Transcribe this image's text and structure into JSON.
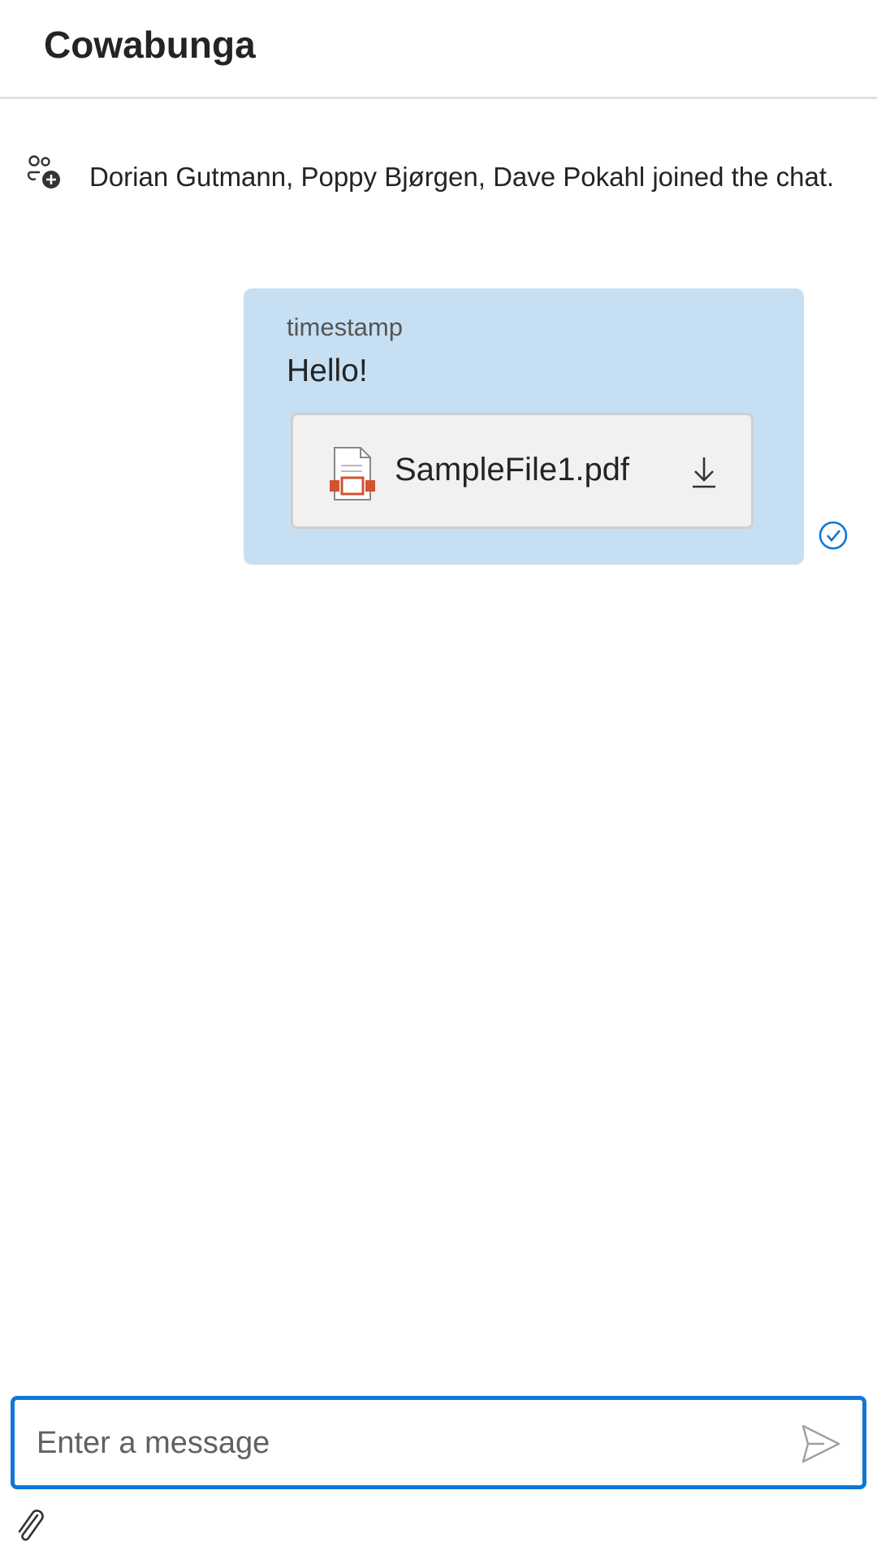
{
  "header": {
    "title": "Cowabunga"
  },
  "system_message": {
    "icon": "person-add-icon",
    "text": "Dorian Gutmann, Poppy Bjørgen, Dave Pokahl joined the chat."
  },
  "message": {
    "timestamp": "timestamp",
    "text": "Hello!",
    "attachment": {
      "name": "SampleFile1.pdf",
      "icon": "pdf-file-icon",
      "action_icon": "download-icon"
    },
    "status_icon": "read-check-icon"
  },
  "composer": {
    "placeholder": "Enter a message",
    "value": "",
    "send_icon": "send-icon",
    "attach_icon": "paperclip-icon"
  },
  "colors": {
    "bubble": "#c7dff3",
    "accent": "#0f78d4",
    "pdf": "#d35230"
  }
}
